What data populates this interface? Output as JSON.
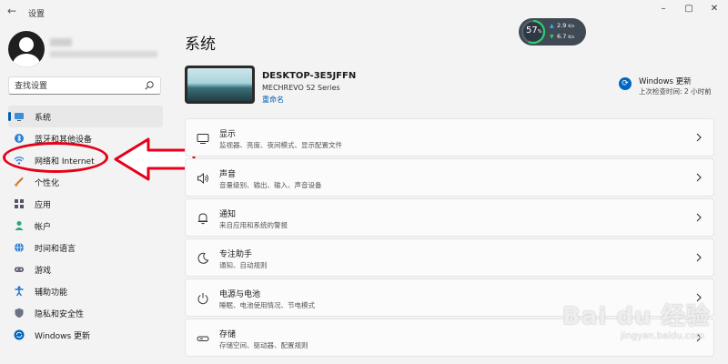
{
  "window": {
    "title": "设置"
  },
  "profile": {},
  "search": {
    "placeholder": "查找设置"
  },
  "sidebar": {
    "items": [
      {
        "label": "系统",
        "icon": "monitor-icon",
        "active": true
      },
      {
        "label": "蓝牙和其他设备",
        "icon": "bluetooth-icon"
      },
      {
        "label": "网络和 Internet",
        "icon": "wifi-icon"
      },
      {
        "label": "个性化",
        "icon": "brush-icon"
      },
      {
        "label": "应用",
        "icon": "apps-icon"
      },
      {
        "label": "帐户",
        "icon": "person-icon"
      },
      {
        "label": "时间和语言",
        "icon": "globe-icon"
      },
      {
        "label": "游戏",
        "icon": "gamepad-icon"
      },
      {
        "label": "辅助功能",
        "icon": "accessibility-icon"
      },
      {
        "label": "隐私和安全性",
        "icon": "shield-icon"
      },
      {
        "label": "Windows 更新",
        "icon": "update-icon"
      }
    ]
  },
  "main": {
    "title": "系统",
    "device": {
      "name": "DESKTOP-3E5JFFN",
      "model": "MECHREVO S2 Series",
      "rename": "重命名"
    },
    "windows_update": {
      "title": "Windows 更新",
      "subtitle": "上次检查时间: 2 小时前"
    },
    "cards": [
      {
        "title": "显示",
        "desc": "监视器、亮度、夜间模式、显示配置文件",
        "icon": "display-icon"
      },
      {
        "title": "声音",
        "desc": "音量级别、输出、输入、声音设备",
        "icon": "speaker-icon"
      },
      {
        "title": "通知",
        "desc": "来自应用和系统的警报",
        "icon": "bell-icon"
      },
      {
        "title": "专注助手",
        "desc": "通知、自动规则",
        "icon": "moon-icon"
      },
      {
        "title": "电源与电池",
        "desc": "睡眠、电池使用情况、节电模式",
        "icon": "power-icon"
      },
      {
        "title": "存储",
        "desc": "存储空间、驱动器、配置规则",
        "icon": "storage-icon"
      }
    ]
  },
  "widget": {
    "percent": "57",
    "unit": "%",
    "upload": "2.9",
    "download": "6.7",
    "speed_unit": "K/s"
  },
  "watermark": {
    "logo": "Bai du 经验",
    "url": "jingyan.baidu.com"
  },
  "colors": {
    "accent": "#005fb8",
    "annotation": "#e6001a"
  }
}
